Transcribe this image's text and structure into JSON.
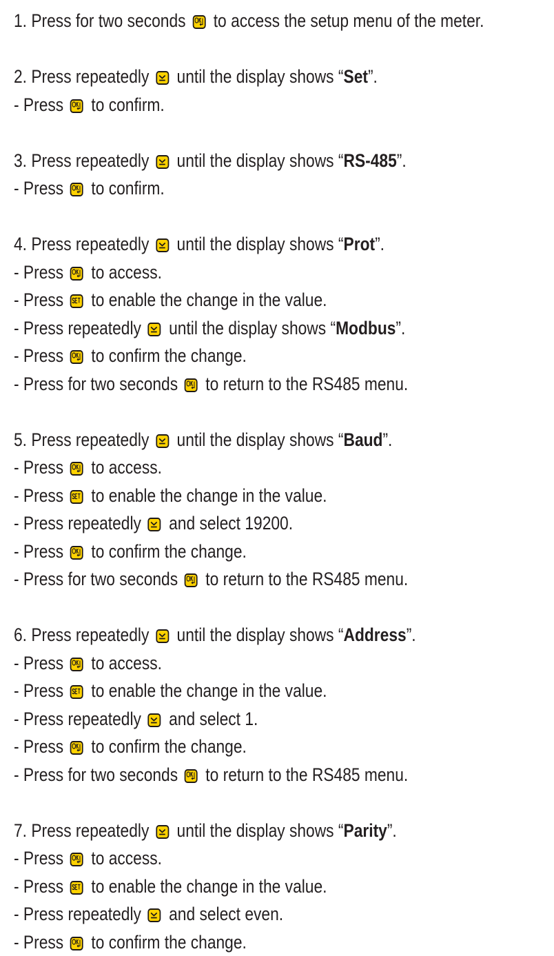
{
  "icons": {
    "ok": "ok-key-icon",
    "down": "down-key-icon",
    "set": "set-key-icon",
    "key_fill": "#ffd200",
    "key_border": "#1f1a17"
  },
  "steps": [
    {
      "lines": [
        [
          {
            "t": "1. Press for two seconds "
          },
          {
            "icon": "ok"
          },
          {
            "t": " to access the setup menu of the meter."
          }
        ]
      ]
    },
    {
      "lines": [
        [
          {
            "t": "2. Press repeatedly "
          },
          {
            "icon": "down"
          },
          {
            "t": " until the display shows “"
          },
          {
            "b": "Set"
          },
          {
            "t": "”."
          }
        ],
        [
          {
            "t": "- Press "
          },
          {
            "icon": "ok"
          },
          {
            "t": " to confirm."
          }
        ]
      ]
    },
    {
      "lines": [
        [
          {
            "t": "3. Press repeatedly "
          },
          {
            "icon": "down"
          },
          {
            "t": " until the display shows “"
          },
          {
            "b": "RS-485"
          },
          {
            "t": "”."
          }
        ],
        [
          {
            "t": "- Press "
          },
          {
            "icon": "ok"
          },
          {
            "t": " to confirm."
          }
        ]
      ]
    },
    {
      "lines": [
        [
          {
            "t": "4. Press repeatedly "
          },
          {
            "icon": "down"
          },
          {
            "t": " until the display shows “"
          },
          {
            "b": "Prot"
          },
          {
            "t": "”."
          }
        ],
        [
          {
            "t": "- Press "
          },
          {
            "icon": "ok"
          },
          {
            "t": " to access."
          }
        ],
        [
          {
            "t": "- Press "
          },
          {
            "icon": "set"
          },
          {
            "t": " to enable the change in the value."
          }
        ],
        [
          {
            "t": "- Press repeatedly "
          },
          {
            "icon": "down"
          },
          {
            "t": " until the display shows “"
          },
          {
            "b": "Modbus"
          },
          {
            "t": "”."
          }
        ],
        [
          {
            "t": "- Press "
          },
          {
            "icon": "ok"
          },
          {
            "t": " to confirm the change."
          }
        ],
        [
          {
            "t": "- Press for two seconds "
          },
          {
            "icon": "ok"
          },
          {
            "t": " to return to the RS485 menu."
          }
        ]
      ]
    },
    {
      "lines": [
        [
          {
            "t": "5. Press repeatedly "
          },
          {
            "icon": "down"
          },
          {
            "t": " until the display shows “"
          },
          {
            "b": "Baud"
          },
          {
            "t": "”."
          }
        ],
        [
          {
            "t": "- Press "
          },
          {
            "icon": "ok"
          },
          {
            "t": " to access."
          }
        ],
        [
          {
            "t": "- Press "
          },
          {
            "icon": "set"
          },
          {
            "t": " to enable the change in the value."
          }
        ],
        [
          {
            "t": "- Press repeatedly "
          },
          {
            "icon": "down"
          },
          {
            "t": " and select 19200."
          }
        ],
        [
          {
            "t": "- Press "
          },
          {
            "icon": "ok"
          },
          {
            "t": " to confirm the change."
          }
        ],
        [
          {
            "t": "- Press for two seconds "
          },
          {
            "icon": "ok"
          },
          {
            "t": " to return to the RS485 menu."
          }
        ]
      ]
    },
    {
      "lines": [
        [
          {
            "t": "6. Press repeatedly "
          },
          {
            "icon": "down"
          },
          {
            "t": " until the display shows “"
          },
          {
            "b": "Address"
          },
          {
            "t": "”."
          }
        ],
        [
          {
            "t": "- Press "
          },
          {
            "icon": "ok"
          },
          {
            "t": " to access."
          }
        ],
        [
          {
            "t": "- Press "
          },
          {
            "icon": "set"
          },
          {
            "t": " to enable the change in the value."
          }
        ],
        [
          {
            "t": "- Press repeatedly "
          },
          {
            "icon": "down"
          },
          {
            "t": " and select 1."
          }
        ],
        [
          {
            "t": "- Press "
          },
          {
            "icon": "ok"
          },
          {
            "t": " to confirm the change."
          }
        ],
        [
          {
            "t": "- Press for two seconds "
          },
          {
            "icon": "ok"
          },
          {
            "t": " to return to the RS485 menu."
          }
        ]
      ]
    },
    {
      "lines": [
        [
          {
            "t": "7. Press repeatedly "
          },
          {
            "icon": "down"
          },
          {
            "t": " until the display shows “"
          },
          {
            "b": "Parity"
          },
          {
            "t": "”."
          }
        ],
        [
          {
            "t": "- Press "
          },
          {
            "icon": "ok"
          },
          {
            "t": " to access."
          }
        ],
        [
          {
            "t": "- Press "
          },
          {
            "icon": "set"
          },
          {
            "t": " to enable the change in the value."
          }
        ],
        [
          {
            "t": "- Press repeatedly "
          },
          {
            "icon": "down"
          },
          {
            "t": " and select even."
          }
        ],
        [
          {
            "t": "- Press "
          },
          {
            "icon": "ok"
          },
          {
            "t": " to confirm the change."
          }
        ]
      ]
    }
  ]
}
